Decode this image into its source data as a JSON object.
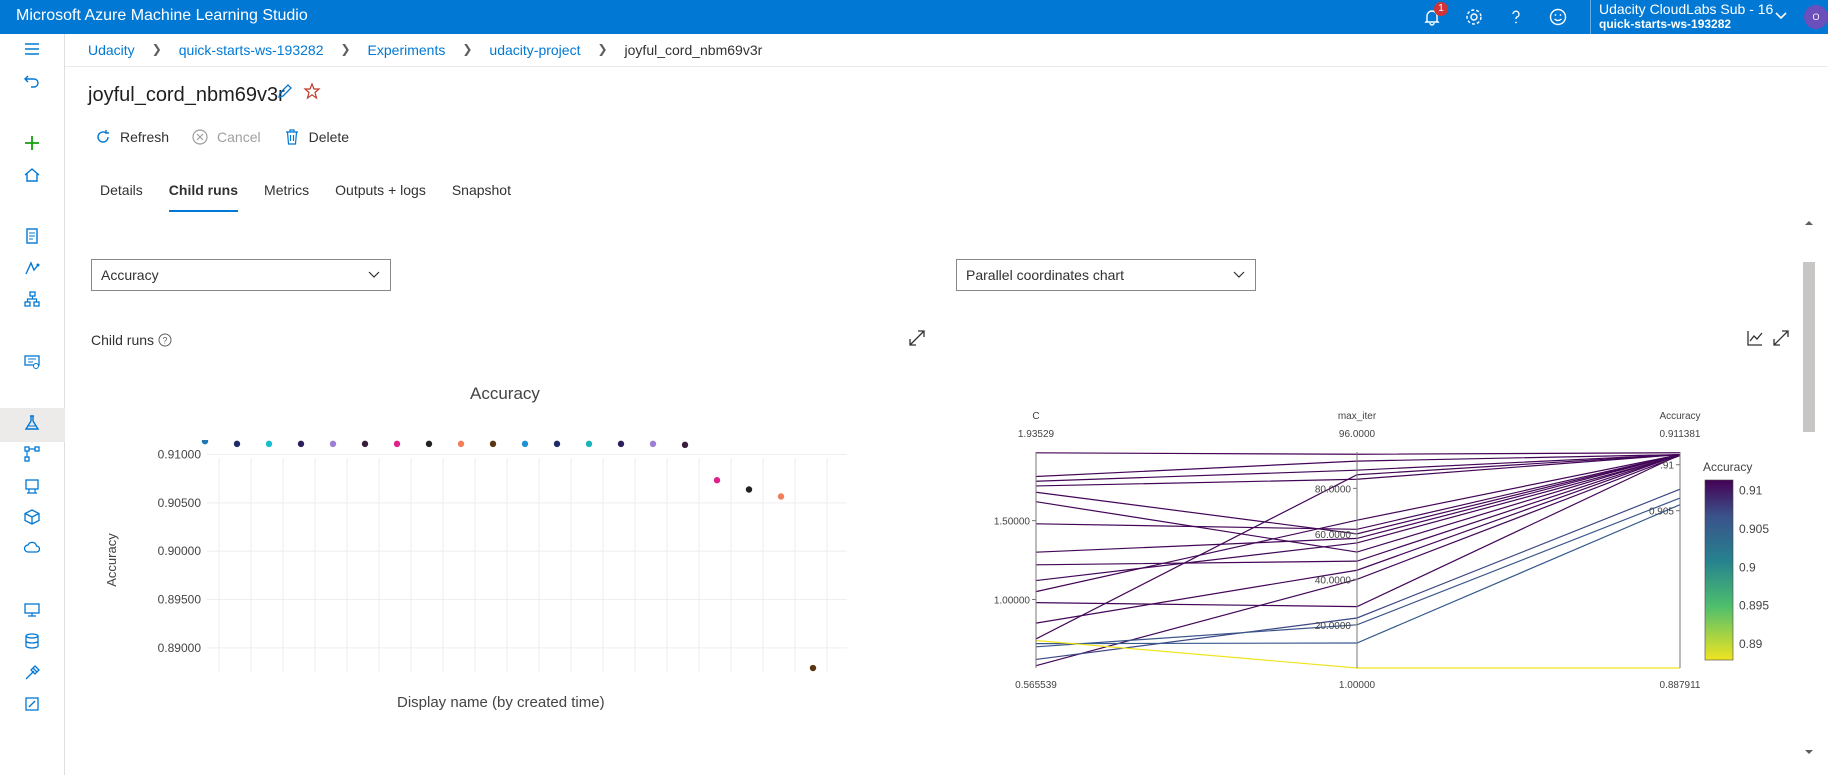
{
  "app": {
    "title": "Microsoft Azure Machine Learning Studio",
    "notifications_count": "1"
  },
  "account": {
    "name": "Udacity CloudLabs Sub - 16",
    "workspace": "quick-starts-ws-193282",
    "avatar_text": "O"
  },
  "breadcrumb": [
    "Udacity",
    "quick-starts-ws-193282",
    "Experiments",
    "udacity-project",
    "joyful_cord_nbm69v3r"
  ],
  "run": {
    "name": "joyful_cord_nbm69v3r"
  },
  "toolbar": {
    "refresh": "Refresh",
    "cancel": "Cancel",
    "delete": "Delete"
  },
  "tabs": [
    "Details",
    "Child runs",
    "Metrics",
    "Outputs + logs",
    "Snapshot"
  ],
  "active_tab": "Child runs",
  "metric_dropdown": "Accuracy",
  "chart_type_dropdown": "Parallel coordinates chart",
  "child_runs_label": "Child runs",
  "colors": {
    "accent": "#0078d4",
    "topbar": "#0078d4"
  },
  "chart_data": [
    {
      "type": "scatter",
      "title": "Accuracy",
      "xlabel": "Display name (by created time)",
      "ylabel": "Accuracy",
      "yticks": [
        "0.91000",
        "0.90500",
        "0.90000",
        "0.89500",
        "0.89000"
      ],
      "ylim": [
        0.8875,
        0.9115
      ],
      "points": [
        {
          "i": 1,
          "y": 0.91138,
          "color": "#1f77b4"
        },
        {
          "i": 2,
          "y": 0.9111,
          "color": "#1f2a6b"
        },
        {
          "i": 3,
          "y": 0.9111,
          "color": "#17becf"
        },
        {
          "i": 4,
          "y": 0.9111,
          "color": "#2c1f5c"
        },
        {
          "i": 5,
          "y": 0.9111,
          "color": "#9b7fd4"
        },
        {
          "i": 6,
          "y": 0.9111,
          "color": "#3a1d3a"
        },
        {
          "i": 7,
          "y": 0.9111,
          "color": "#e0218a"
        },
        {
          "i": 8,
          "y": 0.9111,
          "color": "#222222"
        },
        {
          "i": 9,
          "y": 0.9111,
          "color": "#f07f5a"
        },
        {
          "i": 10,
          "y": 0.9111,
          "color": "#5b3412"
        },
        {
          "i": 11,
          "y": 0.9111,
          "color": "#1f8fd6"
        },
        {
          "i": 12,
          "y": 0.9111,
          "color": "#1f2a6b"
        },
        {
          "i": 13,
          "y": 0.9111,
          "color": "#17b5b5"
        },
        {
          "i": 14,
          "y": 0.9111,
          "color": "#2c1f5c"
        },
        {
          "i": 15,
          "y": 0.9111,
          "color": "#9b7fd4"
        },
        {
          "i": 16,
          "y": 0.911,
          "color": "#3a1d3a"
        },
        {
          "i": 17,
          "y": 0.90734,
          "color": "#e0218a"
        },
        {
          "i": 18,
          "y": 0.90638,
          "color": "#222222"
        },
        {
          "i": 19,
          "y": 0.90566,
          "color": "#f07f5a"
        },
        {
          "i": 20,
          "y": 0.88791,
          "color": "#5b3412"
        }
      ]
    },
    {
      "type": "parallel_coordinates",
      "axes": [
        {
          "name": "C",
          "max": "1.93529",
          "min": "0.565539",
          "ticks": [
            "1.50000",
            "1.00000"
          ]
        },
        {
          "name": "max_iter",
          "max": "96.0000",
          "min": "1.00000",
          "ticks": [
            "80.0000",
            "60.0000",
            "40.0000",
            "20.0000"
          ]
        },
        {
          "name": "Accuracy",
          "max": "0.911381",
          "min": "0.887911",
          "ticks": [
            ".91",
            "0.905"
          ]
        }
      ],
      "colorbar": {
        "title": "Accuracy",
        "ticks": [
          "0.91",
          "0.905",
          "0.9",
          "0.895",
          "0.89"
        ]
      },
      "lines": [
        {
          "c": 1.93,
          "m": 95,
          "a": 0.9113
        },
        {
          "c": 1.78,
          "m": 92,
          "a": 0.9111
        },
        {
          "c": 1.75,
          "m": 88,
          "a": 0.9111
        },
        {
          "c": 1.72,
          "m": 84,
          "a": 0.9111
        },
        {
          "c": 1.68,
          "m": 60,
          "a": 0.9111
        },
        {
          "c": 1.62,
          "m": 52,
          "a": 0.9111
        },
        {
          "c": 1.48,
          "m": 62,
          "a": 0.9111
        },
        {
          "c": 1.3,
          "m": 58,
          "a": 0.9111
        },
        {
          "c": 1.22,
          "m": 48,
          "a": 0.9111
        },
        {
          "c": 1.12,
          "m": 56,
          "a": 0.911
        },
        {
          "c": 1.05,
          "m": 66,
          "a": 0.9111
        },
        {
          "c": 0.98,
          "m": 28,
          "a": 0.9111
        },
        {
          "c": 0.85,
          "m": 44,
          "a": 0.9111
        },
        {
          "c": 0.75,
          "m": 86,
          "a": 0.9111
        },
        {
          "c": 0.58,
          "m": 40,
          "a": 0.911
        },
        {
          "c": 0.62,
          "m": 23,
          "a": 0.90734
        },
        {
          "c": 0.7,
          "m": 20,
          "a": 0.90638
        },
        {
          "c": 0.72,
          "m": 12,
          "a": 0.90566
        },
        {
          "c": 0.74,
          "m": 1,
          "a": 0.88791
        }
      ]
    }
  ]
}
